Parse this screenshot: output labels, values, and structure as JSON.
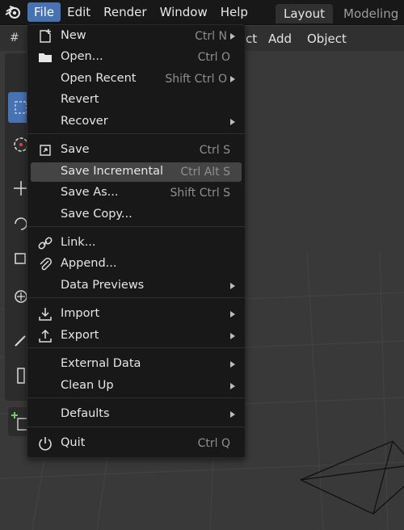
{
  "topbar": {
    "menus": [
      "File",
      "Edit",
      "Render",
      "Window",
      "Help"
    ],
    "workspace_tabs": [
      "Layout",
      "Modeling"
    ]
  },
  "header2": {
    "items": [
      "ct",
      "Add",
      "Object"
    ]
  },
  "file_menu": {
    "items": [
      {
        "label": "New",
        "shortcut": "Ctrl N",
        "submenu": true,
        "icon": "new-file-icon"
      },
      {
        "label": "Open...",
        "shortcut": "Ctrl O",
        "submenu": false,
        "icon": "folder-icon"
      },
      {
        "label": "Open Recent",
        "shortcut": "Shift Ctrl O",
        "submenu": true,
        "icon": ""
      },
      {
        "label": "Revert",
        "shortcut": "",
        "submenu": false,
        "icon": ""
      },
      {
        "label": "Recover",
        "shortcut": "",
        "submenu": true,
        "icon": ""
      },
      {
        "label": "Save",
        "shortcut": "Ctrl S",
        "submenu": false,
        "icon": "save-icon"
      },
      {
        "label": "Save Incremental",
        "shortcut": "Ctrl Alt S",
        "submenu": false,
        "icon": ""
      },
      {
        "label": "Save As...",
        "shortcut": "Shift Ctrl S",
        "submenu": false,
        "icon": ""
      },
      {
        "label": "Save Copy...",
        "shortcut": "",
        "submenu": false,
        "icon": ""
      },
      {
        "label": "Link...",
        "shortcut": "",
        "submenu": false,
        "icon": "link-icon"
      },
      {
        "label": "Append...",
        "shortcut": "",
        "submenu": false,
        "icon": "paperclip-icon"
      },
      {
        "label": "Data Previews",
        "shortcut": "",
        "submenu": true,
        "icon": ""
      },
      {
        "label": "Import",
        "shortcut": "",
        "submenu": true,
        "icon": "import-icon"
      },
      {
        "label": "Export",
        "shortcut": "",
        "submenu": true,
        "icon": "export-icon"
      },
      {
        "label": "External Data",
        "shortcut": "",
        "submenu": true,
        "icon": ""
      },
      {
        "label": "Clean Up",
        "shortcut": "",
        "submenu": true,
        "icon": ""
      },
      {
        "label": "Defaults",
        "shortcut": "",
        "submenu": true,
        "icon": ""
      },
      {
        "label": "Quit",
        "shortcut": "Ctrl Q",
        "submenu": false,
        "icon": "power-icon"
      }
    ]
  },
  "colors": {
    "accent": "#4772b3",
    "menu_bg": "#181818",
    "hover": "#444444",
    "viewport": "#393939"
  }
}
